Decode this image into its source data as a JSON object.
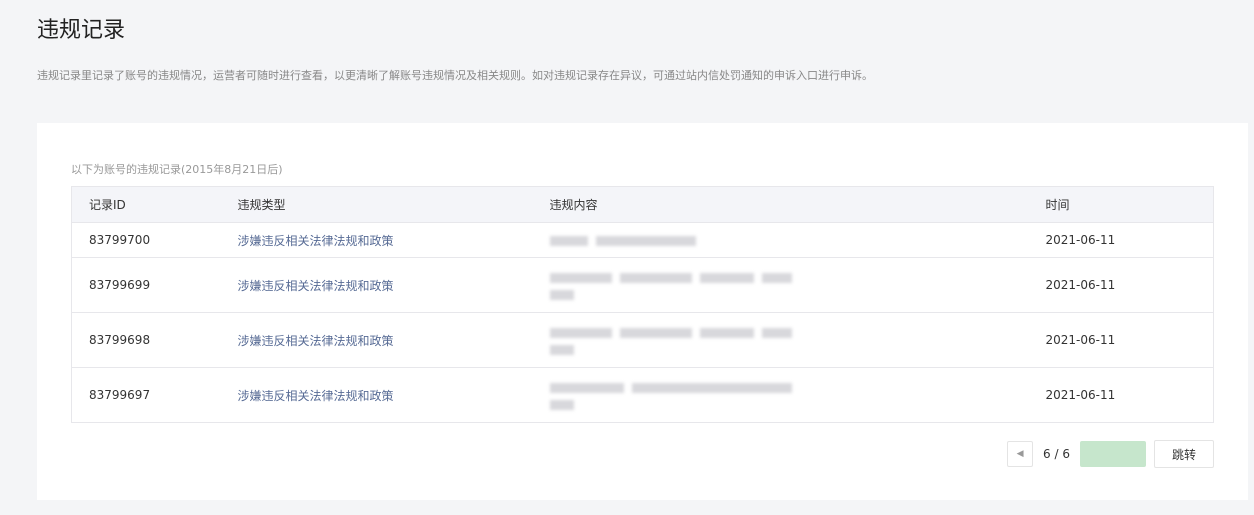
{
  "page": {
    "title": "违规记录",
    "description": "违规记录里记录了账号的违规情况，运营者可随时进行查看，以更清晰了解账号违规情况及相关规则。如对违规记录存在异议，可通过站内信处罚通知的申诉入口进行申诉。"
  },
  "card": {
    "subtitle": "以下为账号的违规记录(2015年8月21日后)"
  },
  "table": {
    "headers": [
      "记录ID",
      "违规类型",
      "违规内容",
      "时间"
    ],
    "rows": [
      {
        "id": "83799700",
        "type": "涉嫌违反相关法律法规和政策",
        "time": "2021-06-11"
      },
      {
        "id": "83799699",
        "type": "涉嫌违反相关法律法规和政策",
        "time": "2021-06-11"
      },
      {
        "id": "83799698",
        "type": "涉嫌违反相关法律法规和政策",
        "time": "2021-06-11"
      },
      {
        "id": "83799697",
        "type": "涉嫌违反相关法律法规和政策",
        "time": "2021-06-11"
      }
    ]
  },
  "pager": {
    "page": "6 / 6",
    "jump_input_value": "",
    "jump_label": "跳转",
    "prev_icon": "triangle-left"
  }
}
